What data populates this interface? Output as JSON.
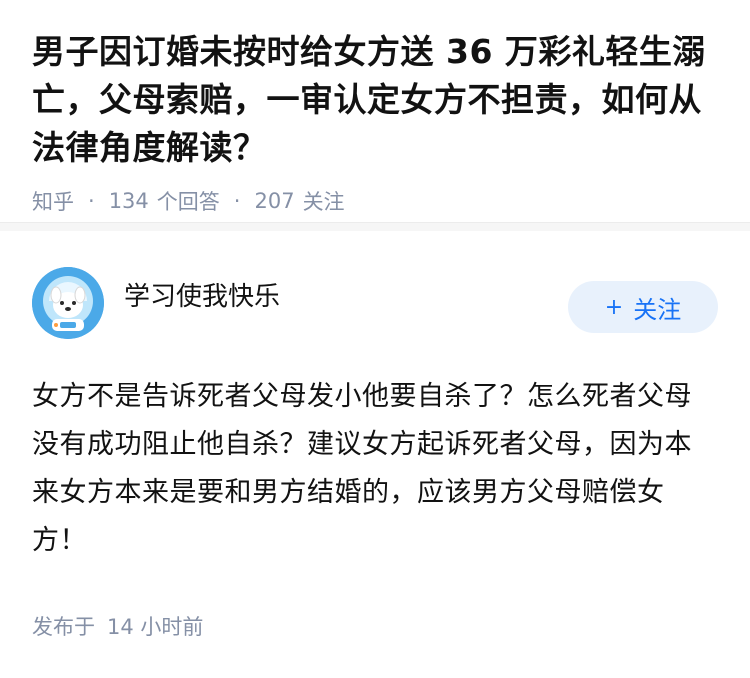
{
  "question": {
    "title": "男子因订婚未按时给女方送 36 万彩礼轻生溺亡，父母索赔，一审认定女方不担责，如何从法律角度解读？",
    "source": "知乎",
    "answer_count": "134",
    "answer_label": "个回答",
    "follow_count": "207",
    "follow_label": "关注"
  },
  "answer": {
    "author_name": "学习使我快乐",
    "avatar_icon": "astronaut-dog-avatar",
    "follow_button": {
      "icon": "plus-icon",
      "plus_symbol": "+",
      "label": "关注"
    },
    "content": "女方不是告诉死者父母发小他要自杀了？怎么死者父母没有成功阻止他自杀？建议女方起诉死者父母，因为本来女方本来是要和男方结婚的，应该男方父母赔偿女方！",
    "published_label": "发布于",
    "published_time": "14 小时前"
  },
  "colors": {
    "primary_text": "#121212",
    "secondary_text": "#8590a6",
    "accent_blue": "#1772f6",
    "follow_button_bg": "#e8f1fc",
    "avatar_bg": "#4ba9e8"
  }
}
